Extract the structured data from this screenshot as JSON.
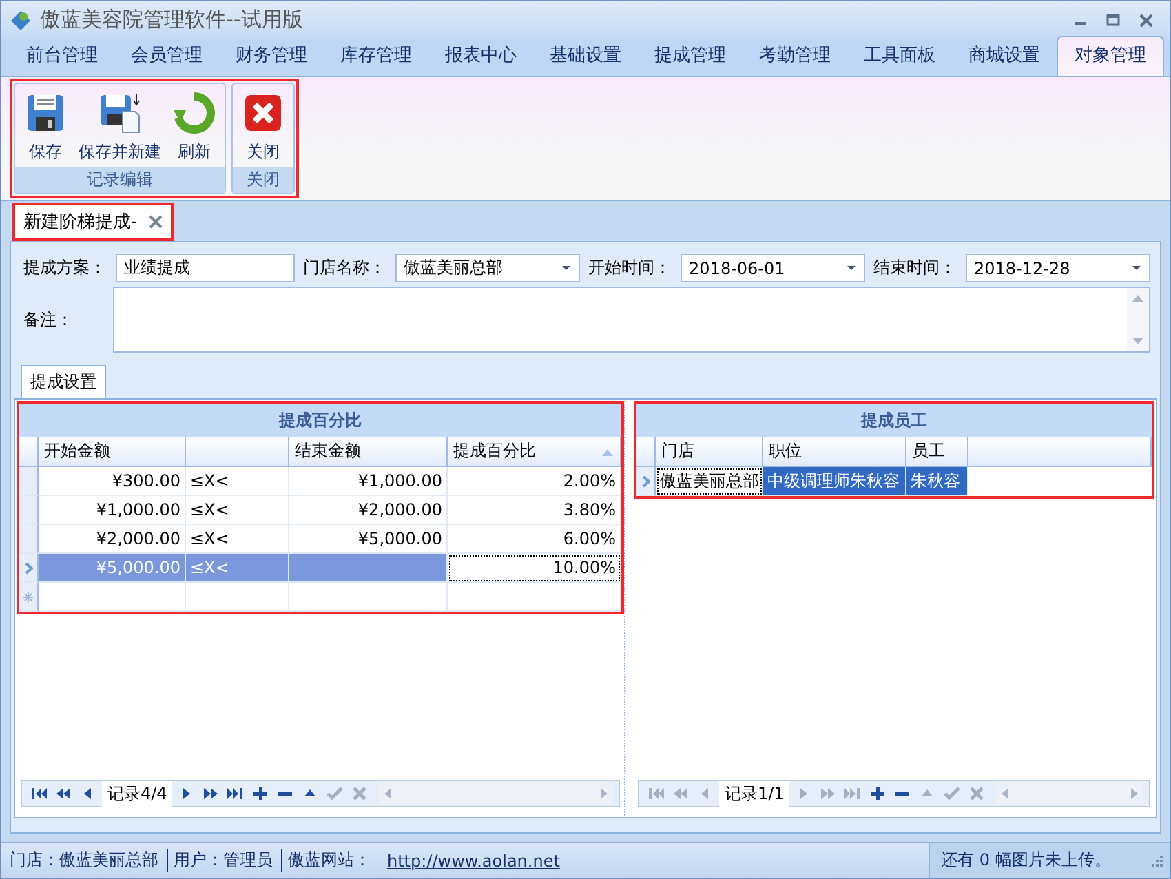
{
  "window": {
    "title": "傲蓝美容院管理软件--试用版"
  },
  "menu_tabs": [
    {
      "label": "前台管理",
      "selected": false
    },
    {
      "label": "会员管理",
      "selected": false
    },
    {
      "label": "财务管理",
      "selected": false
    },
    {
      "label": "库存管理",
      "selected": false
    },
    {
      "label": "报表中心",
      "selected": false
    },
    {
      "label": "基础设置",
      "selected": false
    },
    {
      "label": "提成管理",
      "selected": false
    },
    {
      "label": "考勤管理",
      "selected": false
    },
    {
      "label": "工具面板",
      "selected": false
    },
    {
      "label": "商城设置",
      "selected": false
    },
    {
      "label": "对象管理",
      "selected": true
    }
  ],
  "ribbon": {
    "annotated": true,
    "groups": [
      {
        "caption": "记录编辑",
        "buttons": [
          {
            "label": "保存",
            "kind": "save"
          },
          {
            "label": "保存并新建",
            "kind": "save-new"
          },
          {
            "label": "刷新",
            "kind": "refresh"
          }
        ]
      },
      {
        "caption": "关闭",
        "buttons": [
          {
            "label": "关闭",
            "kind": "close"
          }
        ]
      }
    ]
  },
  "document_tab": {
    "label": "新建阶梯提成-",
    "annotated": true
  },
  "form": {
    "fields": [
      {
        "label": "提成方案：",
        "value": "业绩提成",
        "kind": "text"
      },
      {
        "label": "门店名称：",
        "value": "傲蓝美丽总部",
        "kind": "dropdown"
      },
      {
        "label": "开始时间：",
        "value": "2018-06-01",
        "kind": "dropdown"
      },
      {
        "label": "结束时间：",
        "value": "2018-12-28",
        "kind": "dropdown"
      }
    ],
    "note": {
      "label": "备注："
    }
  },
  "inner_tabs": [
    {
      "label": "提成设置",
      "selected": true
    }
  ],
  "panels": [
    {
      "title": "提成百分比",
      "annotated": true,
      "new_row": true,
      "columns": [
        {
          "label": "开始金额",
          "kind": "amount",
          "sorted": false
        },
        {
          "kind": "text",
          "sorted": false
        },
        {
          "label": "结束金额",
          "kind": "amount",
          "sorted": false
        },
        {
          "label": "提成百分比",
          "kind": "amount",
          "sorted": true
        }
      ],
      "rows": [
        {
          "selected": false,
          "cells": [
            {
              "text": "¥300.00",
              "focused": false
            },
            {
              "text": "≤X<",
              "focused": false
            },
            {
              "text": "¥1,000.00",
              "focused": false
            },
            {
              "text": "2.00%",
              "focused": false
            }
          ]
        },
        {
          "selected": false,
          "cells": [
            {
              "text": "¥1,000.00",
              "focused": false
            },
            {
              "text": "≤X<",
              "focused": false
            },
            {
              "text": "¥2,000.00",
              "focused": false
            },
            {
              "text": "3.80%",
              "focused": false
            }
          ]
        },
        {
          "selected": false,
          "cells": [
            {
              "text": "¥2,000.00",
              "focused": false
            },
            {
              "text": "≤X<",
              "focused": false
            },
            {
              "text": "¥5,000.00",
              "focused": false
            },
            {
              "text": "6.00%",
              "focused": false
            }
          ]
        },
        {
          "selected": true,
          "cells": [
            {
              "text": "¥5,000.00",
              "focused": false
            },
            {
              "text": "≤X<",
              "focused": false
            },
            {
              "text": "",
              "focused": false
            },
            {
              "text": "10.00%",
              "focused": true
            }
          ]
        }
      ],
      "navigator": {
        "record": "记录4/4",
        "buttons": [
          {
            "kind": "first",
            "disabled": false
          },
          {
            "kind": "prev-page",
            "disabled": false
          },
          {
            "kind": "prev",
            "disabled": false
          },
          {
            "kind": "next",
            "disabled": false
          },
          {
            "kind": "next-page",
            "disabled": false
          },
          {
            "kind": "last",
            "disabled": false
          },
          {
            "kind": "add",
            "disabled": false
          },
          {
            "kind": "remove",
            "disabled": false
          },
          {
            "kind": "up",
            "disabled": false
          },
          {
            "kind": "check",
            "disabled": true
          },
          {
            "kind": "cancel",
            "disabled": true
          }
        ]
      }
    },
    {
      "title": "提成员工",
      "annotated": true,
      "new_row": false,
      "columns": [
        {
          "label": "门店",
          "kind": "text",
          "sorted": false
        },
        {
          "label": "职位",
          "kind": "text",
          "sorted": false
        },
        {
          "label": "员工",
          "kind": "text",
          "sorted": false
        }
      ],
      "rows": [
        {
          "selected": true,
          "cells": [
            {
              "text": "傲蓝美丽总部",
              "focused": true
            },
            {
              "text": "中级调理师朱秋容",
              "focused": false
            },
            {
              "text": "朱秋容",
              "focused": false
            }
          ]
        }
      ],
      "navigator": {
        "record": "记录1/1",
        "buttons": [
          {
            "kind": "first",
            "disabled": true
          },
          {
            "kind": "prev-page",
            "disabled": true
          },
          {
            "kind": "prev",
            "disabled": true
          },
          {
            "kind": "next",
            "disabled": true
          },
          {
            "kind": "next-page",
            "disabled": true
          },
          {
            "kind": "last",
            "disabled": true
          },
          {
            "kind": "add",
            "disabled": false
          },
          {
            "kind": "remove",
            "disabled": false
          },
          {
            "kind": "up",
            "disabled": true
          },
          {
            "kind": "check",
            "disabled": true
          },
          {
            "kind": "cancel",
            "disabled": true
          }
        ]
      }
    }
  ],
  "status_bar": {
    "items": [
      {
        "kind": "text",
        "text": "门店：傲蓝美丽总部"
      },
      {
        "kind": "text",
        "text": "用户：管理员"
      },
      {
        "kind": "text",
        "text": "傲蓝网站："
      },
      {
        "kind": "link",
        "text": "http://www.aolan.net"
      }
    ],
    "message": "还有 0 幅图片未上传。"
  }
}
